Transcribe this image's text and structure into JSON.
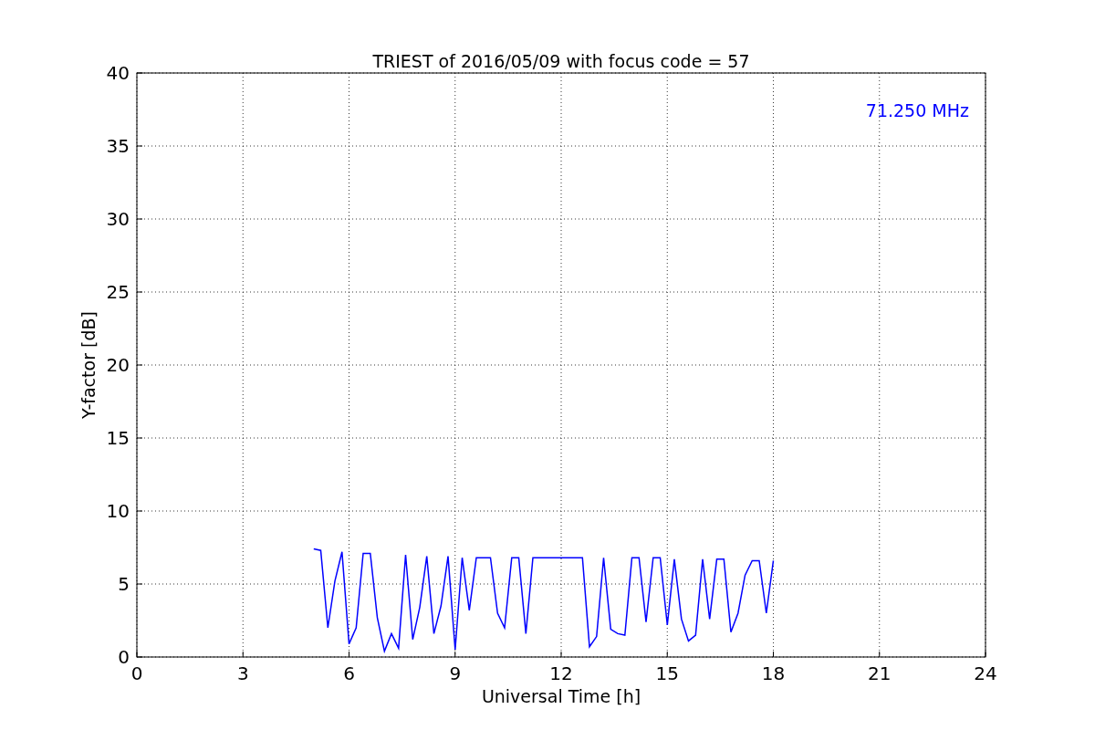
{
  "figure": {
    "chart_data": {
      "type": "line",
      "title": "TRIEST of 2016/05/09 with focus code = 57",
      "xlabel": "Universal Time [h]",
      "ylabel": "Y-factor [dB]",
      "x": [
        5.0,
        5.2,
        5.4,
        5.6,
        5.8,
        6.0,
        6.2,
        6.4,
        6.6,
        6.8,
        7.0,
        7.2,
        7.4,
        7.6,
        7.8,
        8.0,
        8.2,
        8.4,
        8.6,
        8.8,
        9.0,
        9.2,
        9.4,
        9.6,
        9.8,
        10.0,
        10.2,
        10.4,
        10.6,
        10.8,
        11.0,
        11.2,
        11.4,
        11.6,
        11.8,
        12.0,
        12.2,
        12.4,
        12.6,
        12.8,
        13.0,
        13.2,
        13.4,
        13.6,
        13.8,
        14.0,
        14.2,
        14.4,
        14.6,
        14.8,
        15.0,
        15.2,
        15.4,
        15.6,
        15.8,
        16.0,
        16.2,
        16.4,
        16.6,
        16.8,
        17.0,
        17.2,
        17.4,
        17.6,
        17.8,
        18.0
      ],
      "series": [
        {
          "name": "71.250 MHz",
          "color": "#0000ff",
          "values": [
            7.4,
            7.3,
            2.0,
            5.2,
            7.2,
            0.9,
            2.0,
            7.1,
            7.1,
            2.7,
            0.4,
            1.6,
            0.6,
            7.0,
            1.2,
            3.4,
            6.9,
            1.6,
            3.5,
            6.9,
            0.5,
            6.8,
            3.2,
            6.8,
            6.8,
            6.8,
            3.0,
            2.0,
            6.8,
            6.8,
            1.6,
            6.8,
            6.8,
            6.8,
            6.8,
            6.8,
            6.8,
            6.8,
            6.8,
            0.7,
            1.4,
            6.8,
            1.9,
            1.6,
            1.5,
            6.8,
            6.8,
            2.4,
            6.8,
            6.8,
            2.2,
            6.7,
            2.6,
            1.1,
            1.5,
            6.7,
            2.6,
            6.7,
            6.7,
            1.7,
            3.0,
            5.6,
            6.6,
            6.6,
            3.0,
            6.6
          ]
        }
      ],
      "xlim": [
        0,
        24
      ],
      "ylim": [
        0,
        40
      ],
      "xticks": [
        0,
        3,
        6,
        9,
        12,
        15,
        18,
        21,
        24
      ],
      "yticks": [
        0,
        5,
        10,
        15,
        20,
        25,
        30,
        35,
        40
      ],
      "grid": true
    }
  }
}
